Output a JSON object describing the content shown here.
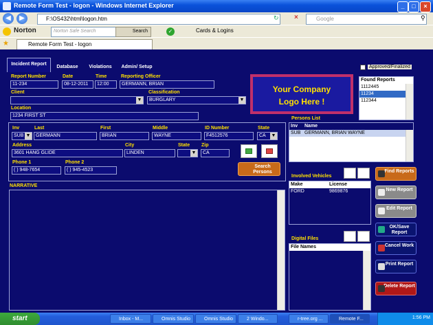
{
  "window": {
    "title": "Remote Form Test - logon - Windows Internet Explorer"
  },
  "browser": {
    "address": "F:\\OS432\\html\\logon.htm",
    "search_placeholder": "Google",
    "norton_label": "Norton",
    "norton_search_placeholder": "Norton Safe Search",
    "norton_search_button": "Search",
    "cards_logins": "Cards & Logins",
    "tab_title": "Remote Form Test - logon"
  },
  "app": {
    "tabs": [
      "Incident Report",
      "Database",
      "Violations",
      "Admin/ Setup"
    ],
    "approved_label": "Approved/Finalized",
    "report": {
      "report_number_label": "Report Number",
      "report_number": "11-234",
      "date_label": "Date",
      "date": "08-12-2011",
      "time_label": "Time",
      "time": "12:00",
      "officer_label": "Reporting Officer",
      "officer": "GERMANN, BRIAN",
      "client_label": "Client",
      "client": "",
      "classification_label": "Classification",
      "classification": "BURGLARY",
      "location_label": "Location",
      "location": "1234 FIRST ST"
    },
    "logo_text": "Your Company Logo Here !",
    "found_reports": {
      "header": "Found Reports",
      "items": [
        "1112445",
        "11234",
        "112344"
      ]
    },
    "person": {
      "inv_label": "Inv",
      "inv": "SUB",
      "last_label": "Last",
      "last": "GERMANN",
      "first_label": "First",
      "first": "BRIAN",
      "middle_label": "Middle",
      "middle": "WAYNE",
      "id_label": "ID Number",
      "id": "F4512576",
      "state_label": "State",
      "state": "CA",
      "address_label": "Address",
      "address": "3601 HANG GLIDE",
      "city_label": "City",
      "city": "LINDEN",
      "state2_label": "State",
      "state2": "",
      "zip_label": "Zip",
      "zip": "CA",
      "phone1_label": "Phone 1",
      "phone1": "(  ) 948-7654",
      "phone2_label": "Phone 2",
      "phone2": "(  ) 945-4523",
      "search_persons": "Search Persons"
    },
    "persons_list": {
      "title": "Persons List",
      "col_inv": "Inv",
      "col_name": "Name",
      "rows": [
        {
          "inv": "SUB",
          "name": "GERMANN, BRIAN WAYNE"
        }
      ]
    },
    "narrative_label": "NARRATIVE",
    "vehicles": {
      "title": "Involved Vehicles",
      "col_make": "Make",
      "col_license": "License",
      "rows": [
        {
          "make": "FORD",
          "license": "9869876"
        }
      ]
    },
    "digital_files": {
      "title": "Digital Files",
      "col": "File Names"
    },
    "buttons": {
      "find": "Find Reports",
      "new": "New Report",
      "edit": "Edit Report",
      "save": "OK/Save Report",
      "cancel": "Cancel Work",
      "print": "Print Report",
      "delete": "Delete Report"
    },
    "colors": {
      "background": "#0B0B6E",
      "label": "#FFE000",
      "logo_border": "#C0306A"
    }
  },
  "taskbar": {
    "start": "start",
    "items": [
      "Inbox - M...",
      "Omnis Studio",
      "Omnis Studio",
      "2 Windo...",
      "r-tree.org ...",
      "Remote F..."
    ],
    "clock": "1:56 PM"
  }
}
